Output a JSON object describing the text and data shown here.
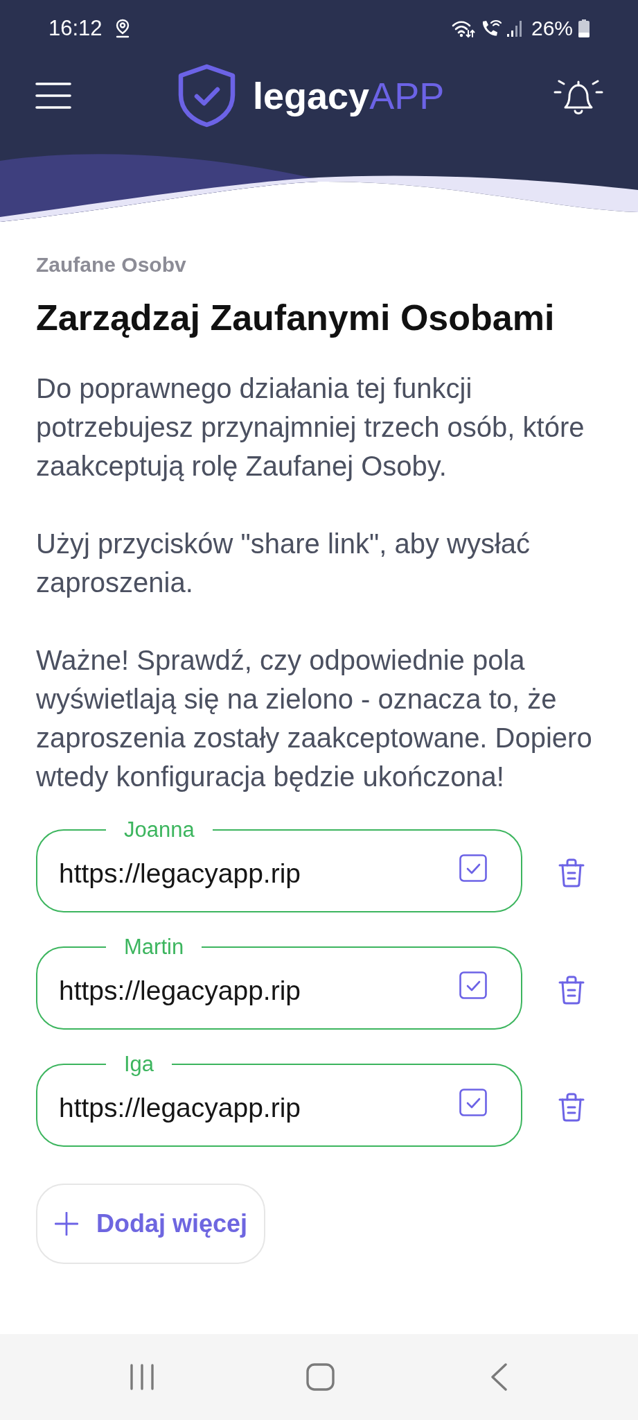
{
  "status_bar": {
    "time": "16:12",
    "battery": "26%"
  },
  "header": {
    "logo": {
      "text": "legacy",
      "accent": "APP"
    }
  },
  "page": {
    "overline": "Zaufane Osobv",
    "title": "Zarządzaj Zaufanymi Osobami",
    "paragraphs": [
      "Do poprawnego działania tej funkcji potrzebujesz przynajmniej trzech osób, które zaakceptują rolę Zaufanej Osoby.",
      "Użyj przycisków \"share link\", aby wysłać zaproszenia.",
      "Ważne! Sprawdź, czy odpowiednie pola wyświetlają się na zielono - oznacza to, że zaproszenia zostały zaakceptowane. Dopiero wtedy konfiguracja będzie ukończona!"
    ]
  },
  "trusted_people": [
    {
      "name": "Joanna",
      "link": "https://legacyapp.rip",
      "accepted": true,
      "checked": true
    },
    {
      "name": "Martin",
      "link": "https://legacyapp.rip",
      "accepted": true,
      "checked": true
    },
    {
      "name": "Iga",
      "link": "https://legacyapp.rip",
      "accepted": true,
      "checked": true
    }
  ],
  "add_button": {
    "label": "Dodaj więcej"
  }
}
